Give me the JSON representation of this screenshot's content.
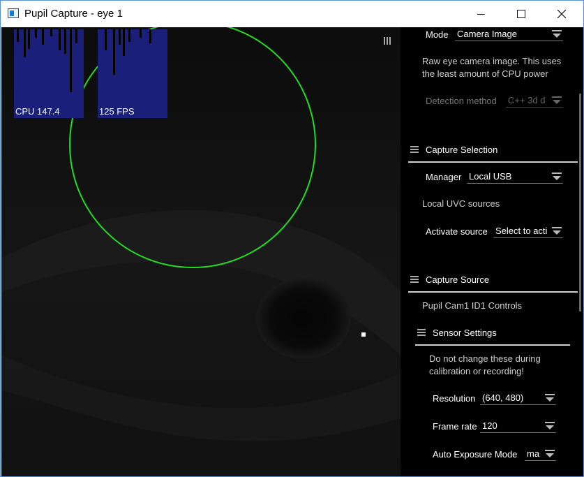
{
  "window": {
    "title": "Pupil Capture - eye 1"
  },
  "graphs": {
    "cpu_label": "CPU 147.4",
    "fps_label": "125 FPS"
  },
  "panel": {
    "mode_label": "Mode",
    "mode_value": "Camera Image",
    "mode_info": [
      "Raw eye camera image. This uses",
      "the least amount of CPU power"
    ],
    "detection_label": "Detection method",
    "detection_value": "C++ 3d d",
    "capture_selection": {
      "title": "Capture Selection",
      "manager_label": "Manager",
      "manager_value": "Local USB",
      "uvc_info": "Local UVC sources",
      "activate_label": "Activate source",
      "activate_value": "Select to acti"
    },
    "capture_source": {
      "title": "Capture Source",
      "controls_label": "Pupil Cam1 ID1 Controls",
      "sensor_settings": {
        "title": "Sensor Settings",
        "warning": [
          "Do not change these during",
          "calibration or recording!"
        ],
        "resolution_label": "Resolution",
        "resolution_value": "(640, 480)",
        "frame_rate_label": "Frame rate",
        "frame_rate_value": "120",
        "auto_exposure_label": "Auto Exposure Mode",
        "auto_exposure_value": "ma"
      }
    }
  },
  "colors": {
    "circle": "#22dd22",
    "graph_bg": "#1a1f7a",
    "panel_bg": "#000000"
  }
}
